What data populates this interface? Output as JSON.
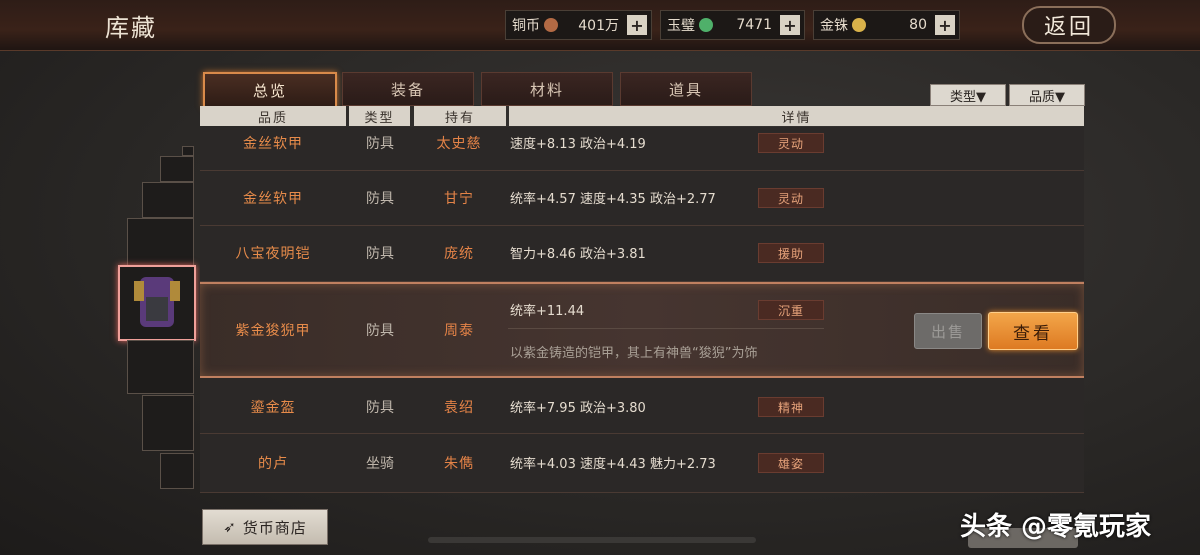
{
  "header": {
    "title": "库藏",
    "back_label": "返回"
  },
  "currencies": [
    {
      "label": "铜币",
      "value": "401万",
      "coin_color": "#b36a44"
    },
    {
      "label": "玉璧",
      "value": "7471",
      "coin_color": "#4fb06a"
    },
    {
      "label": "金铢",
      "value": "80",
      "coin_color": "#d9b24a"
    }
  ],
  "tabs": [
    {
      "label": "总览"
    },
    {
      "label": "装备"
    },
    {
      "label": "材料"
    },
    {
      "label": "道具"
    }
  ],
  "filters": {
    "type_label": "类型▼",
    "quality_label": "品质▼"
  },
  "columns": {
    "quality": "品质",
    "type": "类型",
    "holder": "持有",
    "detail": "详情"
  },
  "rows": [
    {
      "name": "金丝软甲",
      "type": "防具",
      "holder": "太史慈",
      "stats": "速度+8.13 政治+4.19",
      "tag": "灵动"
    },
    {
      "name": "金丝软甲",
      "type": "防具",
      "holder": "甘宁",
      "stats": "统率+4.57 速度+4.35 政治+2.77",
      "tag": "灵动"
    },
    {
      "name": "八宝夜明铠",
      "type": "防具",
      "holder": "庞统",
      "stats": "智力+8.46 政治+3.81",
      "tag": "援助"
    },
    {
      "name": "紫金狻猊甲",
      "type": "防具",
      "holder": "周泰",
      "stats": "统率+11.44",
      "tag": "沉重",
      "desc": "以紫金铸造的铠甲，其上有神兽“狻猊”为饰"
    },
    {
      "name": "鎏金盔",
      "type": "防具",
      "holder": "袁绍",
      "stats": "统率+7.95 政治+3.80",
      "tag": "精神"
    },
    {
      "name": "的卢",
      "type": "坐骑",
      "holder": "朱儁",
      "stats": "统率+4.03 速度+4.43 魅力+2.73",
      "tag": "雄姿"
    }
  ],
  "actions": {
    "sell_label": "出售",
    "view_label": "查看"
  },
  "shop_label": "货币商店",
  "watermark": "头条 @零氪玩家"
}
